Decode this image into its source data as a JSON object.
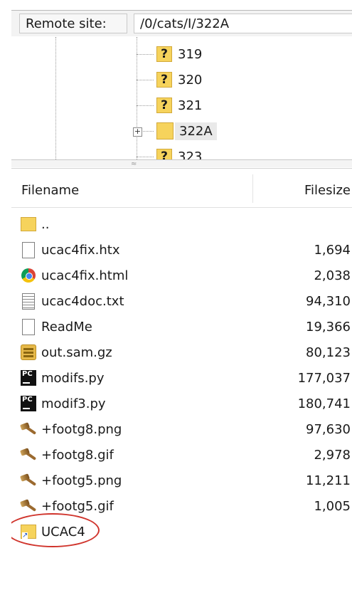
{
  "remote_site": {
    "label": "Remote site:",
    "path": "/0/cats/I/322A"
  },
  "tree": {
    "items": [
      {
        "label": "319",
        "icon": "unknown-folder-icon"
      },
      {
        "label": "320",
        "icon": "unknown-folder-icon"
      },
      {
        "label": "321",
        "icon": "unknown-folder-icon"
      },
      {
        "label": "322A",
        "icon": "folder-icon",
        "selected": true,
        "expandable": true
      },
      {
        "label": "323",
        "icon": "unknown-folder-icon"
      }
    ]
  },
  "file_list": {
    "columns": {
      "filename": "Filename",
      "filesize": "Filesize"
    },
    "rows": [
      {
        "name": "..",
        "size": "",
        "icon": "folder-icon"
      },
      {
        "name": "ucac4fix.htx",
        "size": "1,694",
        "icon": "document-icon"
      },
      {
        "name": "ucac4fix.html",
        "size": "2,038",
        "icon": "chrome-icon"
      },
      {
        "name": "ucac4doc.txt",
        "size": "94,310",
        "icon": "text-file-icon"
      },
      {
        "name": "ReadMe",
        "size": "19,366",
        "icon": "document-icon"
      },
      {
        "name": "out.sam.gz",
        "size": "80,123",
        "icon": "archive-icon"
      },
      {
        "name": "modifs.py",
        "size": "177,037",
        "icon": "pycharm-icon"
      },
      {
        "name": "modif3.py",
        "size": "180,741",
        "icon": "pycharm-icon"
      },
      {
        "name": "+footg8.png",
        "size": "97,630",
        "icon": "image-icon"
      },
      {
        "name": "+footg8.gif",
        "size": "2,978",
        "icon": "image-icon"
      },
      {
        "name": "+footg5.png",
        "size": "11,211",
        "icon": "image-icon"
      },
      {
        "name": "+footg5.gif",
        "size": "1,005",
        "icon": "image-icon"
      },
      {
        "name": "UCAC4",
        "size": "",
        "icon": "folder-shortcut-icon",
        "highlighted": true
      }
    ]
  },
  "colors": {
    "highlight_ring": "#d0342c",
    "folder": "#f6d35c"
  }
}
